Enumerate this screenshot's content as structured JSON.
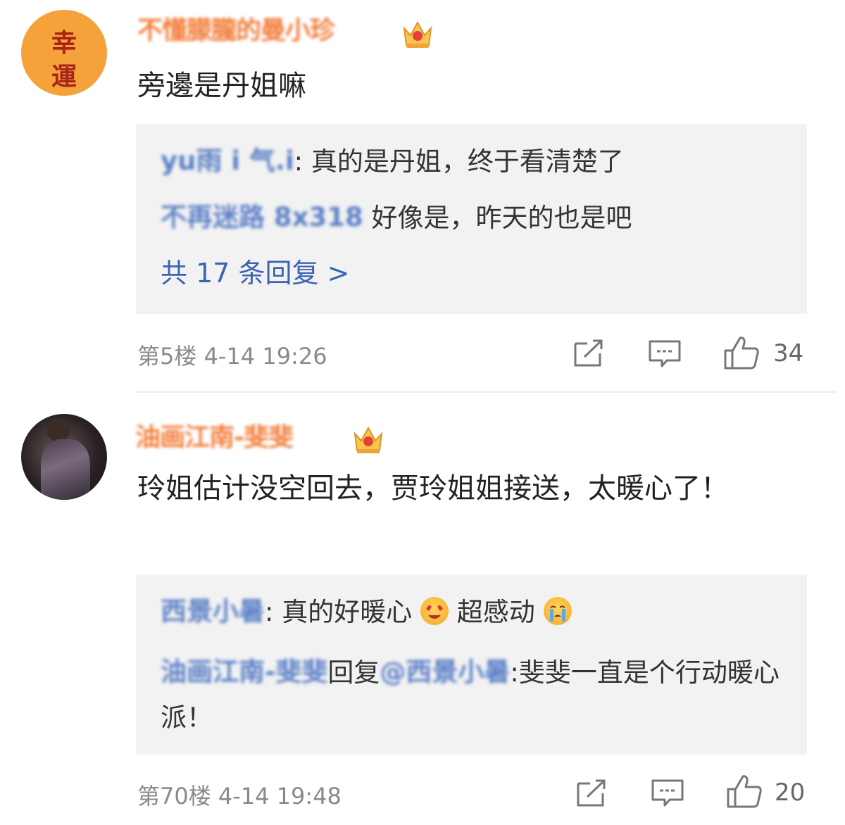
{
  "comments": [
    {
      "avatar_text": [
        "幸",
        "運"
      ],
      "username": "不懂朦朧的曼小珍",
      "text": "旁邊是丹姐嘛",
      "replies": [
        {
          "user": "yu雨 i 气.i",
          "text": ": 真的是丹姐，终于看清楚了"
        },
        {
          "user": "不再迷路 8x318",
          "text": " 好像是，昨天的也是吧"
        }
      ],
      "more_replies": "共 17 条回复 >",
      "floor_time": "第5楼 4-14 19:26",
      "like_count": "34"
    },
    {
      "username": "油画江南-斐斐",
      "text": "玲姐估计没空回去，贾玲姐姐接送，太暖心了！",
      "replies": [
        {
          "user": "西景小暑",
          "text_before": ": 真的好暖心 ",
          "text_middle": " 超感动 "
        },
        {
          "user": "油画江南-斐斐",
          "reply_word": "回复",
          "reply_target": "@西景小暑",
          "text": ":斐斐一直是个行动暖心派！"
        }
      ],
      "floor_time": "第70楼 4-14 19:48",
      "like_count": "20"
    }
  ],
  "icons": {
    "share": "share-icon",
    "comment": "comment-icon",
    "like": "thumbs-up-icon",
    "crown": "crown-badge-icon"
  },
  "colors": {
    "link": "#3b63b3",
    "username": "#f27d3a",
    "meta": "#8a8a8a",
    "reply_bg": "#f2f2f2"
  }
}
